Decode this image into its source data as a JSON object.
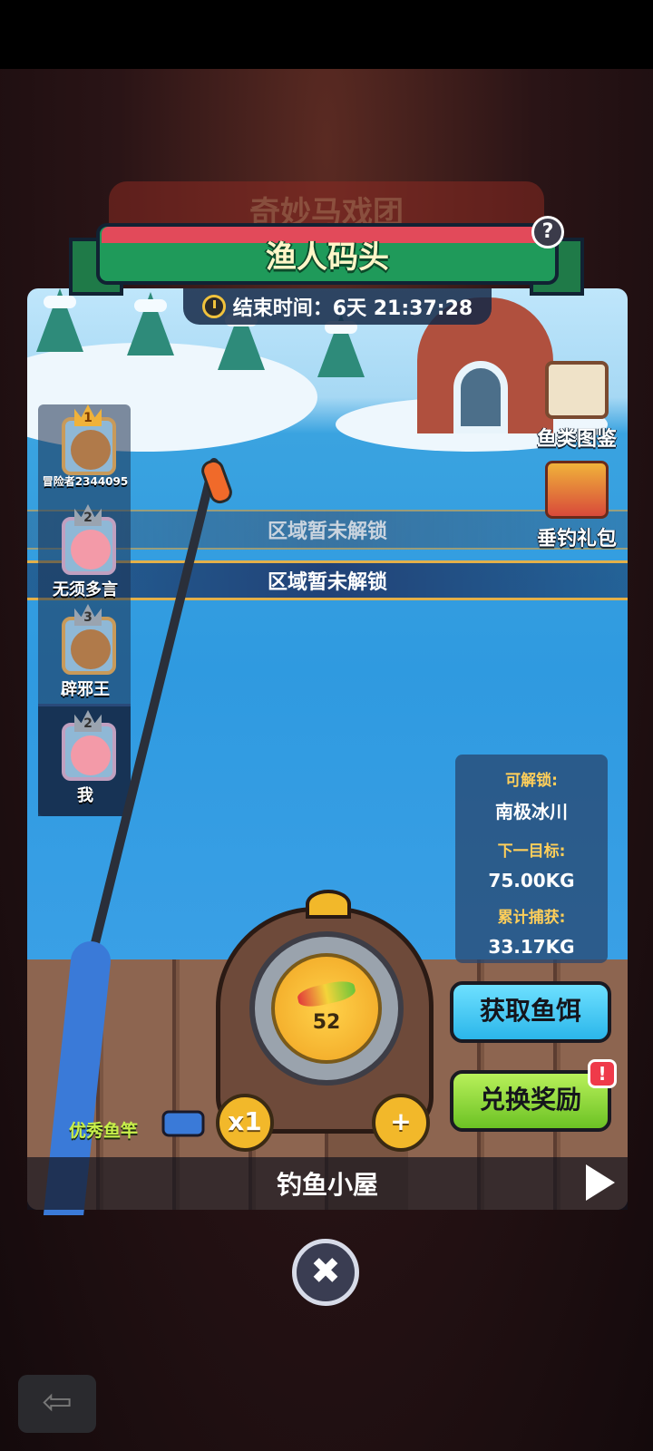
{
  "background_title": "奇妙马戏团",
  "header": {
    "title": "渔人码头",
    "help_label": "?"
  },
  "timer": {
    "label": "结束时间：6天 21:37:28"
  },
  "zones": {
    "locked_1": "区域暂未解锁",
    "locked_2": "区域暂未解锁"
  },
  "ranking": [
    {
      "rank": "1",
      "name": "冒险者2344095",
      "avatar": "capybara"
    },
    {
      "rank": "2",
      "name": "无须多言",
      "avatar": "pig"
    },
    {
      "rank": "3",
      "name": "辟邪王",
      "avatar": "capybara"
    },
    {
      "rank": "2",
      "name": "我",
      "avatar": "pig"
    }
  ],
  "side_buttons": {
    "fish_guide": "鱼类图鉴",
    "fishing_pack": "垂钓礼包"
  },
  "info": {
    "unlock_label": "可解锁:",
    "unlock_value": "南极冰川",
    "target_label": "下一目标:",
    "target_value": "75.00KG",
    "total_label": "累计捕获:",
    "total_value": "33.17KG"
  },
  "reel": {
    "bait_count": "52",
    "multiplier": "x1",
    "plus": "+"
  },
  "buttons": {
    "get_bait": "获取鱼饵",
    "redeem": "兑换奖励",
    "redeem_badge": "!"
  },
  "rod_name": "优秀鱼竿",
  "bottom": {
    "label": "钓鱼小屋"
  },
  "close_label": "✖",
  "back_label": "⇦"
}
